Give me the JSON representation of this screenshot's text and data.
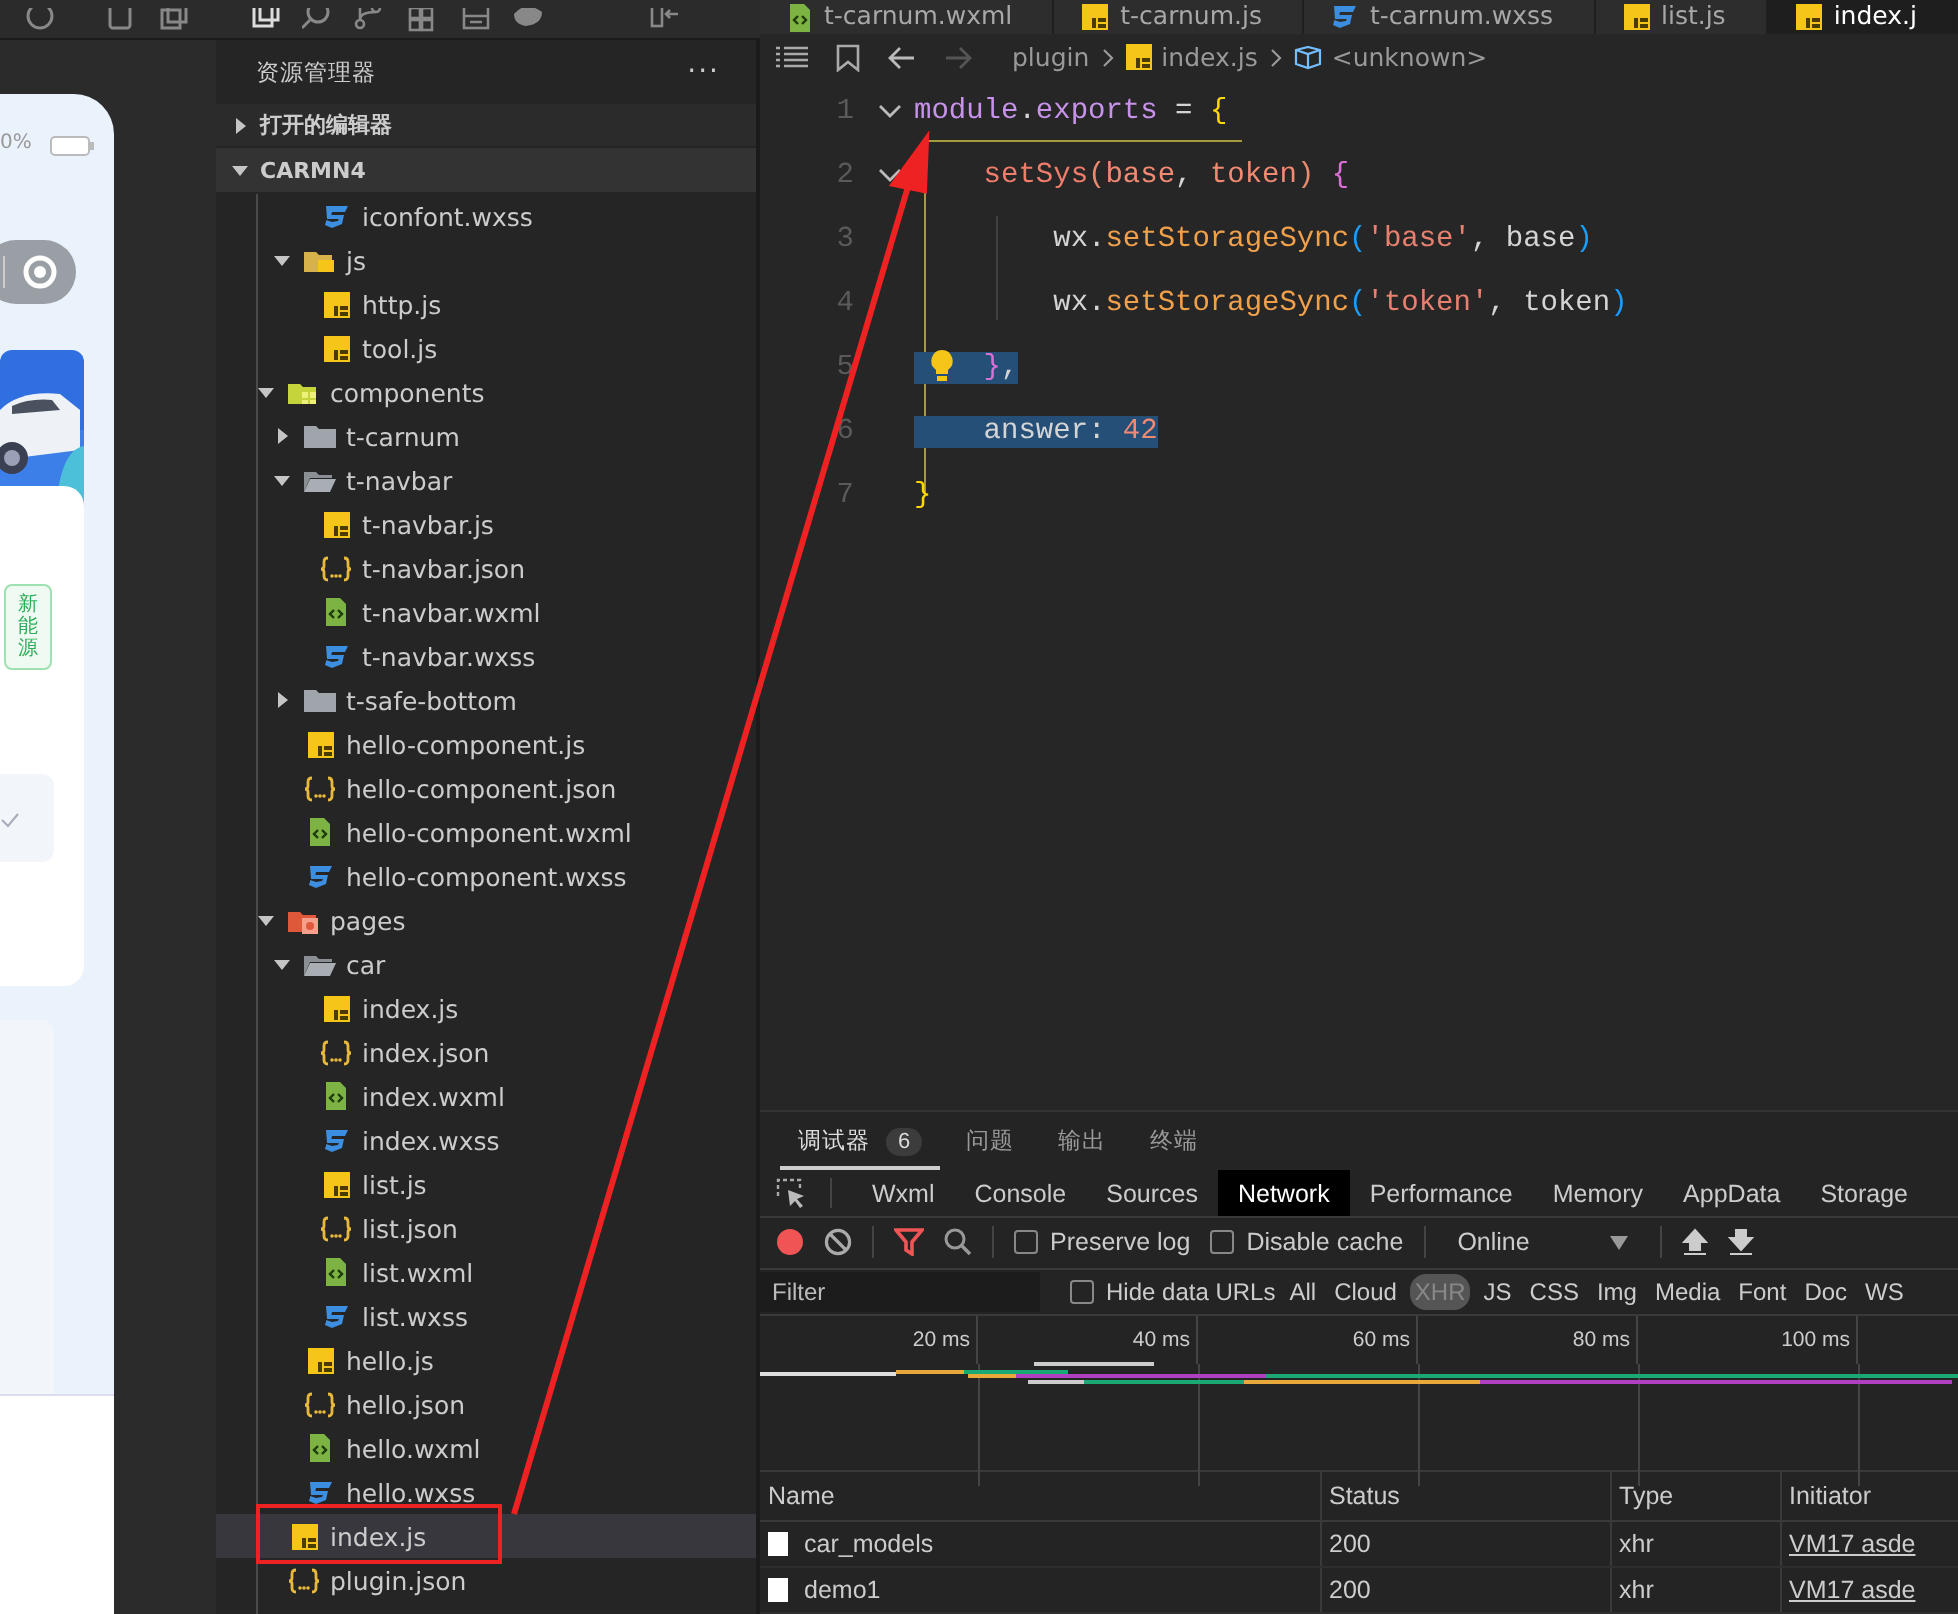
{
  "simulator": {
    "battery": "0%",
    "tag": "新能源"
  },
  "explorer": {
    "title": "资源管理器",
    "more": "···",
    "sections": [
      {
        "label": "打开的编辑器",
        "expanded": false
      },
      {
        "label": "CARMN4",
        "expanded": true
      }
    ],
    "tree": [
      {
        "children": [
          {
            "children": [
              {
                "name": "iconfont.wxss",
                "kind": "wxss",
                "selected": false
              }
            ]
          },
          {
            "name": "js",
            "kind": "folder-js",
            "expanded": true,
            "selected": false,
            "children": [
              {
                "name": "http.js",
                "kind": "js",
                "selected": false
              },
              {
                "name": "tool.js",
                "kind": "js",
                "selected": false
              }
            ]
          }
        ]
      },
      {
        "name": "components",
        "kind": "folder-components",
        "expanded": true,
        "selected": false,
        "children": [
          {
            "name": "t-carnum",
            "kind": "folder",
            "expanded": false,
            "selected": false
          },
          {
            "name": "t-navbar",
            "kind": "folder",
            "expanded": true,
            "selected": false,
            "children": [
              {
                "name": "t-navbar.js",
                "kind": "js",
                "selected": false
              },
              {
                "name": "t-navbar.json",
                "kind": "json",
                "selected": false
              },
              {
                "name": "t-navbar.wxml",
                "kind": "wxml",
                "selected": false
              },
              {
                "name": "t-navbar.wxss",
                "kind": "wxss",
                "selected": false
              }
            ]
          },
          {
            "name": "t-safe-bottom",
            "kind": "folder",
            "expanded": false,
            "selected": false
          },
          {
            "name": "hello-component.js",
            "kind": "js",
            "selected": false
          },
          {
            "name": "hello-component.json",
            "kind": "json",
            "selected": false
          },
          {
            "name": "hello-component.wxml",
            "kind": "wxml",
            "selected": false
          },
          {
            "name": "hello-component.wxss",
            "kind": "wxss",
            "selected": false
          }
        ]
      },
      {
        "name": "pages",
        "kind": "folder-pages",
        "expanded": true,
        "selected": false,
        "children": [
          {
            "name": "car",
            "kind": "folder",
            "expanded": true,
            "selected": false,
            "children": [
              {
                "name": "index.js",
                "kind": "js",
                "selected": false
              },
              {
                "name": "index.json",
                "kind": "json",
                "selected": false
              },
              {
                "name": "index.wxml",
                "kind": "wxml",
                "selected": false
              },
              {
                "name": "index.wxss",
                "kind": "wxss",
                "selected": false
              },
              {
                "name": "list.js",
                "kind": "js",
                "selected": false
              },
              {
                "name": "list.json",
                "kind": "json",
                "selected": false
              },
              {
                "name": "list.wxml",
                "kind": "wxml",
                "selected": false
              },
              {
                "name": "list.wxss",
                "kind": "wxss",
                "selected": false
              }
            ]
          },
          {
            "name": "hello.js",
            "kind": "js",
            "selected": false
          },
          {
            "name": "hello.json",
            "kind": "json",
            "selected": false
          },
          {
            "name": "hello.wxml",
            "kind": "wxml",
            "selected": false
          },
          {
            "name": "hello.wxss",
            "kind": "wxss",
            "selected": false
          }
        ]
      },
      {
        "name": "index.js",
        "kind": "js",
        "selected": true
      },
      {
        "name": "plugin.json",
        "kind": "json",
        "selected": false
      }
    ]
  },
  "editor": {
    "tabs": [
      {
        "label": "t-carnum.wxml",
        "kind": "wxml",
        "selected": false
      },
      {
        "label": "t-carnum.js",
        "kind": "js",
        "selected": false
      },
      {
        "label": "t-carnum.wxss",
        "kind": "wxss",
        "selected": false
      },
      {
        "label": "list.js",
        "kind": "js",
        "selected": false
      },
      {
        "label": "index.j",
        "kind": "js",
        "selected": true
      }
    ],
    "breadcrumb": [
      {
        "label": "plugin",
        "kind": "folder"
      },
      {
        "label": "index.js",
        "kind": "js"
      },
      {
        "label": "<unknown>",
        "kind": "symbol"
      }
    ],
    "lines": [
      {
        "number": "1",
        "foldable": true,
        "hint": false,
        "selected": false,
        "tokens": [
          {
            "text": "module",
            "kind": "prop"
          },
          {
            "text": ".",
            "kind": "plain"
          },
          {
            "text": "exports",
            "kind": "prop"
          },
          {
            "text": " = ",
            "kind": "plain"
          },
          {
            "text": "{",
            "kind": "brace"
          }
        ]
      },
      {
        "number": "2",
        "foldable": true,
        "hint": false,
        "selected": false,
        "tokens": [
          {
            "text": "    setSys",
            "kind": "func"
          },
          {
            "text": "(",
            "kind": "paren"
          },
          {
            "text": "base",
            "kind": "param"
          },
          {
            "text": ", ",
            "kind": "plain"
          },
          {
            "text": "token",
            "kind": "param"
          },
          {
            "text": ")",
            "kind": "paren"
          },
          {
            "text": " {",
            "kind": "brace2"
          }
        ]
      },
      {
        "number": "3",
        "foldable": false,
        "hint": false,
        "selected": false,
        "tokens": [
          {
            "text": "        wx",
            "kind": "plain"
          },
          {
            "text": ".",
            "kind": "plain"
          },
          {
            "text": "setStorageSync",
            "kind": "method"
          },
          {
            "text": "(",
            "kind": "brace3"
          },
          {
            "text": "'base'",
            "kind": "str"
          },
          {
            "text": ", base",
            "kind": "plain"
          },
          {
            "text": ")",
            "kind": "brace3"
          }
        ]
      },
      {
        "number": "4",
        "foldable": false,
        "hint": false,
        "selected": false,
        "tokens": [
          {
            "text": "        wx",
            "kind": "plain"
          },
          {
            "text": ".",
            "kind": "plain"
          },
          {
            "text": "setStorageSync",
            "kind": "method"
          },
          {
            "text": "(",
            "kind": "brace3"
          },
          {
            "text": "'token'",
            "kind": "str"
          },
          {
            "text": ", token",
            "kind": "plain"
          },
          {
            "text": ")",
            "kind": "brace3"
          }
        ]
      },
      {
        "number": "5",
        "foldable": false,
        "hint": true,
        "selected": true,
        "tokens": [
          {
            "text": "    }",
            "kind": "brace2"
          },
          {
            "text": ",",
            "kind": "plain"
          }
        ]
      },
      {
        "number": "6",
        "foldable": false,
        "hint": false,
        "selected": true,
        "tokens": [
          {
            "text": "    answer",
            "kind": "plain"
          },
          {
            "text": ": ",
            "kind": "plain"
          },
          {
            "text": "42",
            "kind": "num"
          }
        ]
      },
      {
        "number": "7",
        "foldable": false,
        "hint": false,
        "selected": false,
        "tokens": [
          {
            "text": "}",
            "kind": "brace"
          }
        ]
      }
    ]
  },
  "devtools": {
    "panel_tabs": [
      {
        "label": "调试器",
        "badge": "6",
        "selected": true
      },
      {
        "label": "问题",
        "selected": false
      },
      {
        "label": "输出",
        "selected": false
      },
      {
        "label": "终端",
        "selected": false
      }
    ],
    "tabs": [
      {
        "label": "Wxml",
        "selected": false
      },
      {
        "label": "Console",
        "selected": false
      },
      {
        "label": "Sources",
        "selected": false
      },
      {
        "label": "Network",
        "selected": true
      },
      {
        "label": "Performance",
        "selected": false
      },
      {
        "label": "Memory",
        "selected": false
      },
      {
        "label": "AppData",
        "selected": false
      },
      {
        "label": "Storage",
        "selected": false
      }
    ],
    "toolbar": {
      "recording": true,
      "options": [
        {
          "label": "Preserve log",
          "checked": false
        },
        {
          "label": "Disable cache",
          "checked": false
        }
      ],
      "throttle": "Online"
    },
    "filter": {
      "placeholder": "Filter",
      "hide_data_urls": {
        "label": "Hide data URLs",
        "checked": false
      },
      "types": [
        {
          "label": "All",
          "selected": false
        },
        {
          "label": "Cloud",
          "selected": false
        },
        {
          "label": "XHR",
          "selected": true
        },
        {
          "label": "JS",
          "selected": false
        },
        {
          "label": "CSS",
          "selected": false
        },
        {
          "label": "Img",
          "selected": false
        },
        {
          "label": "Media",
          "selected": false
        },
        {
          "label": "Font",
          "selected": false
        },
        {
          "label": "Doc",
          "selected": false
        },
        {
          "label": "WS",
          "selected": false
        }
      ]
    },
    "timeline": {
      "ticks": [
        "20 ms",
        "40 ms",
        "60 ms",
        "80 ms",
        "100 ms"
      ]
    },
    "table": {
      "columns": [
        "Name",
        "Status",
        "Type",
        "Initiator"
      ],
      "rows": [
        {
          "name": "car_models",
          "status": "200",
          "type": "xhr",
          "initiator": "VM17 asde"
        },
        {
          "name": "demo1",
          "status": "200",
          "type": "xhr",
          "initiator": "VM17 asde"
        }
      ]
    }
  }
}
